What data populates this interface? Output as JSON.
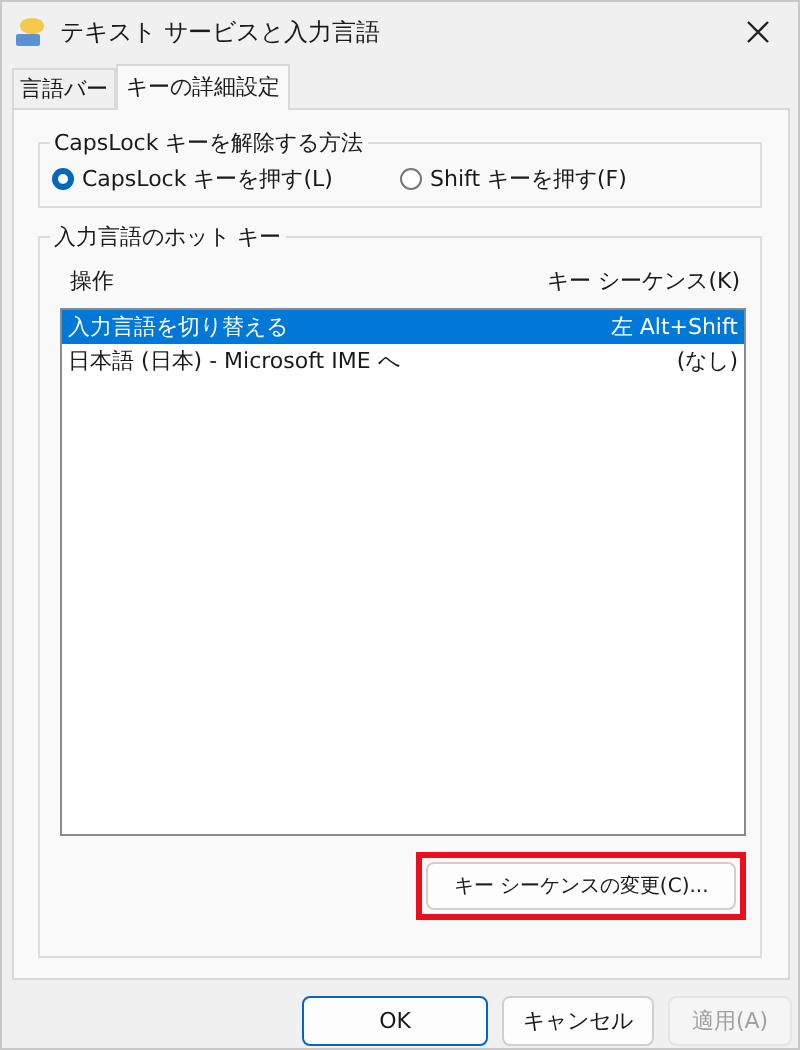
{
  "window": {
    "title": "テキスト サービスと入力言語"
  },
  "tabs": [
    {
      "label": "言語バー",
      "selected": false
    },
    {
      "label": "キーの詳細設定",
      "selected": true
    }
  ],
  "capslock_group": {
    "title": "CapsLock キーを解除する方法",
    "options": [
      {
        "label": "CapsLock キーを押す(L)",
        "selected": true
      },
      {
        "label": "Shift キーを押す(F)",
        "selected": false
      }
    ]
  },
  "hotkey_group": {
    "title": "入力言語のホット キー",
    "columns": [
      "操作",
      "キー シーケンス(K)"
    ],
    "rows": [
      {
        "action": "入力言語を切り替える",
        "sequence": "左 Alt+Shift",
        "selected": true
      },
      {
        "action": "日本語 (日本) - Microsoft IME へ",
        "sequence": "(なし)",
        "selected": false
      }
    ],
    "change_button": {
      "label": "キー シーケンスの変更(C)...",
      "highlighted": true
    }
  },
  "buttons": [
    {
      "label": "OK",
      "kind": "default",
      "disabled": false
    },
    {
      "label": "キャンセル",
      "kind": "normal",
      "disabled": false
    },
    {
      "label": "適用(A)",
      "kind": "normal",
      "disabled": true
    }
  ]
}
